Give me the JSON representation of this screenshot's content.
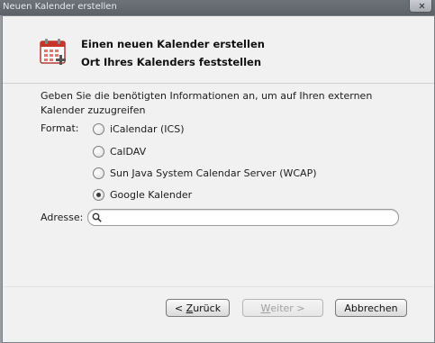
{
  "window": {
    "title": "Neuen Kalender erstellen"
  },
  "header": {
    "icon": "calendar-add-icon",
    "title": "Einen neuen Kalender erstellen",
    "subtitle": "Ort Ihres Kalenders feststellen"
  },
  "form": {
    "description": "Geben Sie die benötigten Informationen an, um auf Ihren externen Kalender zuzugreifen",
    "format_label": "Format:",
    "format_options": [
      {
        "label": "iCalendar (ICS)",
        "checked": false
      },
      {
        "label": "CalDAV",
        "checked": false
      },
      {
        "label": "Sun Java System Calendar Server (WCAP)",
        "checked": false
      },
      {
        "label": "Google Kalender",
        "checked": true
      }
    ],
    "address_label": "Adresse:",
    "address_value": "",
    "address_icon": "search-icon"
  },
  "buttons": {
    "back_prefix": "< ",
    "back_access": "Z",
    "back_rest": "urück",
    "next_access": "W",
    "next_rest": "eiter >",
    "cancel": "Abbrechen"
  },
  "colors": {
    "titlebar": "#62676d",
    "dialog_bg": "#f1f1f1",
    "icon_red": "#c9342a"
  }
}
